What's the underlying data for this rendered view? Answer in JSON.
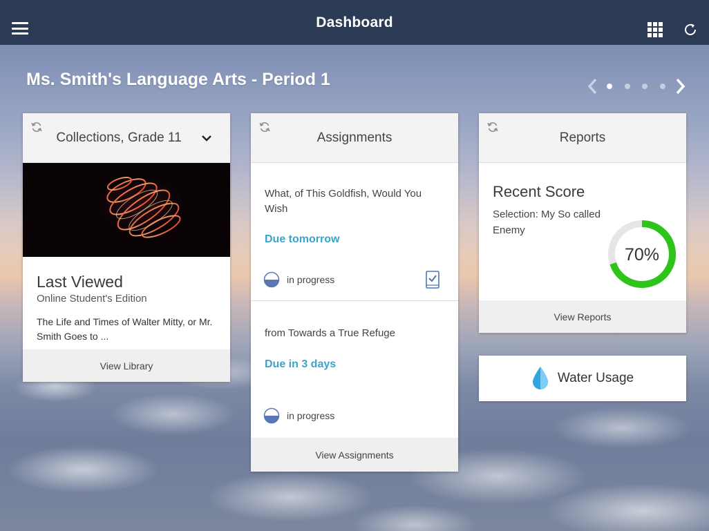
{
  "topbar": {
    "title": "Dashboard",
    "menu_icon": "hamburger-menu-icon",
    "apps_icon": "apps-grid-icon",
    "refresh_icon": "refresh-icon"
  },
  "header": {
    "class_title": "Ms. Smith's Language Arts - Period 1"
  },
  "pager": {
    "pages": 4,
    "active_page": 1
  },
  "collections": {
    "heading": "Collections, Grade 11",
    "last_viewed_title": "Last Viewed",
    "last_viewed_sub": "Online Student's Edition",
    "last_viewed_desc": "The Life and Times of Walter Mitty, or Mr. Smith Goes to ...",
    "footer": "View Library"
  },
  "assignments": {
    "heading": "Assignments",
    "items": [
      {
        "title": "What, of This Goldfish, Would You Wish",
        "due": "Due tomorrow",
        "status": "in progress"
      },
      {
        "title": "from Towards a True Refuge",
        "due": "Due in 3 days",
        "status": "in progress"
      }
    ],
    "footer": "View Assignments"
  },
  "reports": {
    "heading": "Reports",
    "recent_score_title": "Recent Score",
    "selection": "Selection: My So called Enemy",
    "score_text": "70%",
    "score_value": 0.7,
    "footer": "View Reports"
  },
  "water": {
    "label": "Water Usage",
    "icon": "water-drop-icon"
  },
  "colors": {
    "topbar": "#2b3a55",
    "accent": "#3aa4c8",
    "score_ring": "#2fc41a",
    "progress": "#5a77b5"
  }
}
